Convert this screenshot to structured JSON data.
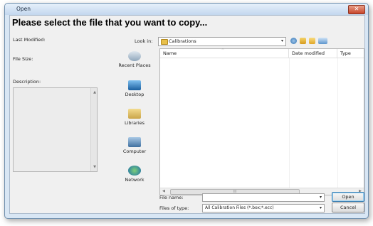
{
  "window": {
    "title": "Open",
    "close_glyph": "✕"
  },
  "heading": "Please select the file that you want to copy...",
  "left_panel": {
    "last_modified_label": "Last Modified:",
    "file_size_label": "File Size:",
    "description_label": "Description:"
  },
  "look_in": {
    "label": "Look in:",
    "value": "Calibrations"
  },
  "places": [
    {
      "label": "Recent Places",
      "icon": "recent-places-icon"
    },
    {
      "label": "Desktop",
      "icon": "desktop-icon"
    },
    {
      "label": "Libraries",
      "icon": "libraries-icon"
    },
    {
      "label": "Computer",
      "icon": "computer-icon"
    },
    {
      "label": "Network",
      "icon": "network-icon"
    }
  ],
  "columns": [
    {
      "label": "Name"
    },
    {
      "label": "Date modified"
    },
    {
      "label": "Type"
    }
  ],
  "file_name": {
    "label": "File name:",
    "value": ""
  },
  "file_type": {
    "label": "Files of type:",
    "value": "All Calibration Files (*.box;*.ecc)"
  },
  "buttons": {
    "open": "Open",
    "cancel": "Cancel"
  },
  "scroll_thumb_glyph": "III"
}
